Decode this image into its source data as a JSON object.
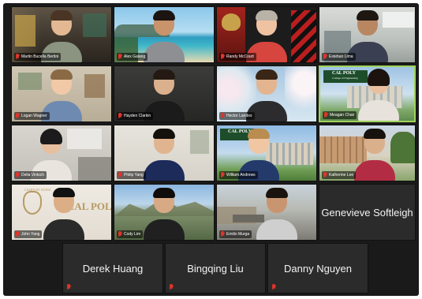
{
  "meeting": {
    "participants": [
      {
        "name": "Martin Bucella Bertini",
        "muted": true
      },
      {
        "name": "Alex Galang",
        "muted": true
      },
      {
        "name": "Randy McCourt",
        "muted": true
      },
      {
        "name": "Esteban Lima",
        "muted": true
      },
      {
        "name": "Logan Wagner",
        "muted": true
      },
      {
        "name": "Hayden Clarkin",
        "muted": true
      },
      {
        "name": "Hector Landes",
        "muted": true
      },
      {
        "name": "Meagan Chan",
        "muted": true,
        "active_speaker": true
      },
      {
        "name": "Delia Vintsch",
        "muted": true
      },
      {
        "name": "Philip Yang",
        "muted": true
      },
      {
        "name": "William Andrews",
        "muted": true
      },
      {
        "name": "Katherine Lee",
        "muted": true
      },
      {
        "name": "John Yang",
        "muted": true
      },
      {
        "name": "Cody Lim",
        "muted": true
      },
      {
        "name": "Emilio Murga",
        "muted": true
      },
      {
        "name": "Genevieve Softleigh",
        "muted": true,
        "video": false
      },
      {
        "name": "Derek Huang",
        "muted": true,
        "video": false
      },
      {
        "name": "Bingqing Liu",
        "muted": true,
        "video": false
      },
      {
        "name": "Danny Nguyen",
        "muted": true,
        "video": false
      }
    ],
    "backgrounds": {
      "cal_poly_logo": "CAL POLY",
      "cal_poly_sub": "College of Engineering",
      "lab_sign": "CAL POLY",
      "lab_sign_top": "LEARN BY DOING"
    }
  },
  "colors": {
    "window_bg": "#1a1a1a",
    "audio_tile_bg": "#2b2b2b",
    "active_speaker_border": "#9fd35a",
    "muted_icon": "#e0342a",
    "cal_poly_green": "#1e4d2b"
  }
}
